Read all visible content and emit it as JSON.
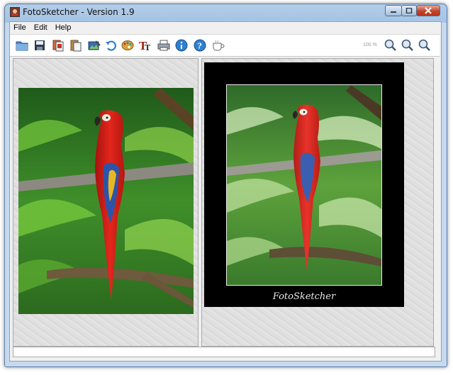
{
  "window": {
    "title": "FotoSketcher - Version 1.9"
  },
  "menu": {
    "items": [
      "File",
      "Edit",
      "Help"
    ]
  },
  "toolbar": {
    "buttons": [
      "open-folder-icon",
      "save-disk-icon",
      "copy-icon",
      "paste-icon",
      "process-image-icon",
      "undo-icon",
      "palette-icon",
      "text-icon",
      "print-icon",
      "info-icon",
      "help-icon",
      "coffee-cup-icon"
    ],
    "zoom_label": "100 %",
    "zoom_buttons": [
      "zoom-in-icon",
      "zoom-out-icon",
      "zoom-fit-icon"
    ]
  },
  "sketch": {
    "signature": "FotoSketcher"
  },
  "colors": {
    "frame": "#a5c3e4",
    "close": "#c2442c",
    "accent": "#2f7fd1"
  }
}
